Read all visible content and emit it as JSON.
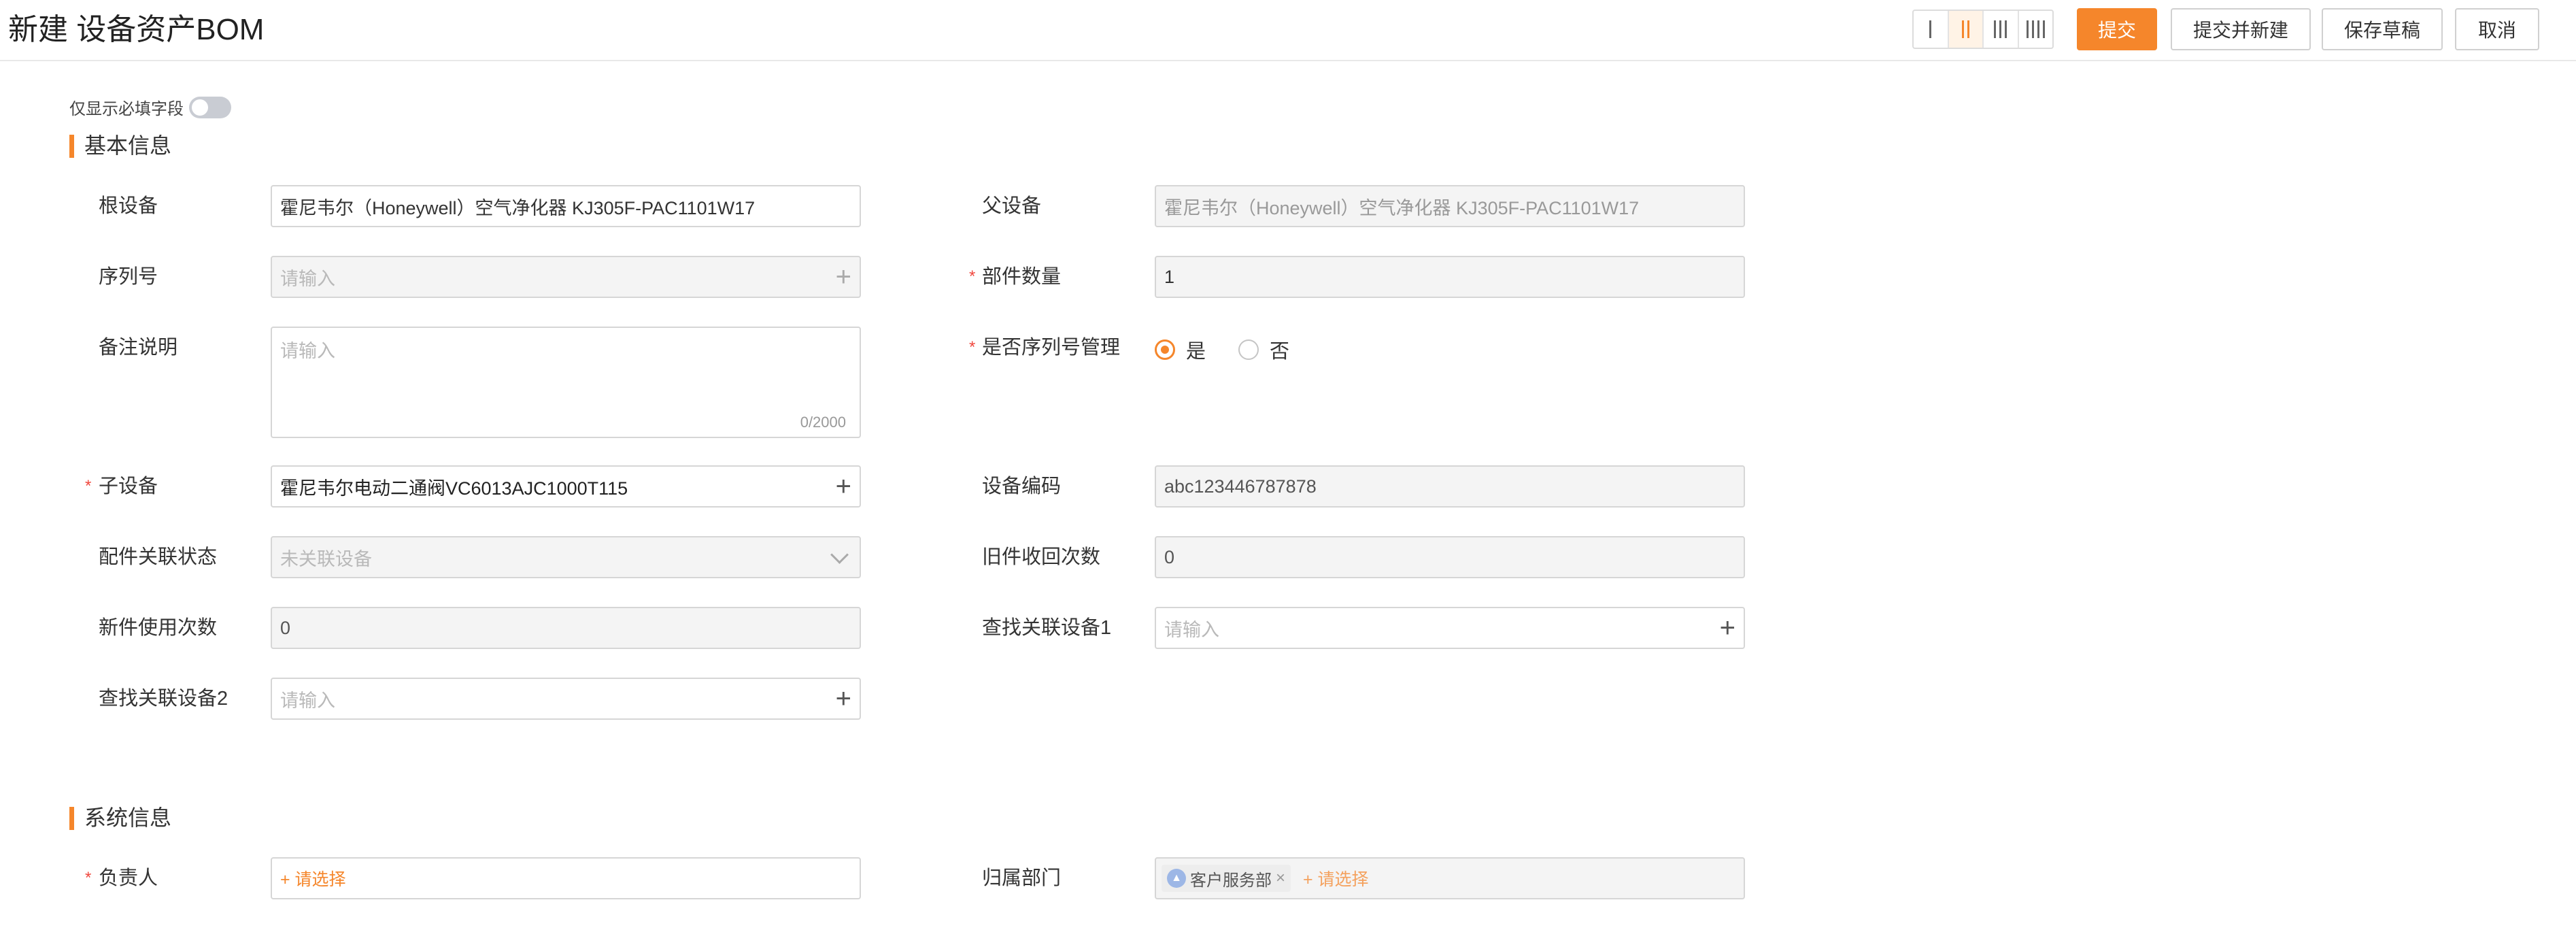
{
  "header": {
    "title": "新建 设备资产BOM",
    "buttons": {
      "submit": "提交",
      "submit_new": "提交并新建",
      "save_draft": "保存草稿",
      "cancel": "取消"
    },
    "column_layout_selected": 2
  },
  "required_toggle": {
    "label": "仅显示必填字段",
    "on": false
  },
  "sections": {
    "basic": "基本信息",
    "system": "系统信息"
  },
  "fields": {
    "root_device": {
      "label": "根设备",
      "value": "霍尼韦尔（Honeywell）空气净化器 KJ305F-PAC1101W17"
    },
    "parent_device": {
      "label": "父设备",
      "value": "霍尼韦尔（Honeywell）空气净化器 KJ305F-PAC1101W17"
    },
    "serial_no": {
      "label": "序列号",
      "placeholder": "请输入"
    },
    "part_qty": {
      "label": "部件数量",
      "value": "1"
    },
    "remark": {
      "label": "备注说明",
      "placeholder": "请输入",
      "count": "0/2000"
    },
    "serial_managed": {
      "label": "是否序列号管理",
      "options": [
        "是",
        "否"
      ],
      "selected": "是"
    },
    "child_device": {
      "label": "子设备",
      "value": "霍尼韦尔电动二通阀VC6013AJC1000T115"
    },
    "device_code": {
      "label": "设备编码",
      "value": "abc123446787878"
    },
    "part_link_status": {
      "label": "配件关联状态",
      "value": "未关联设备"
    },
    "old_recycle_count": {
      "label": "旧件收回次数",
      "value": "0"
    },
    "new_use_count": {
      "label": "新件使用次数",
      "value": "0"
    },
    "find_linked_1": {
      "label": "查找关联设备1",
      "placeholder": "请输入"
    },
    "find_linked_2": {
      "label": "查找关联设备2",
      "placeholder": "请输入"
    },
    "owner": {
      "label": "负责人",
      "add_text": "+ 请选择"
    },
    "department": {
      "label": "归属部门",
      "tag": "客户服务部",
      "add_text": "+ 请选择"
    }
  },
  "colors": {
    "accent": "#f5862b",
    "required": "#f0483e"
  }
}
